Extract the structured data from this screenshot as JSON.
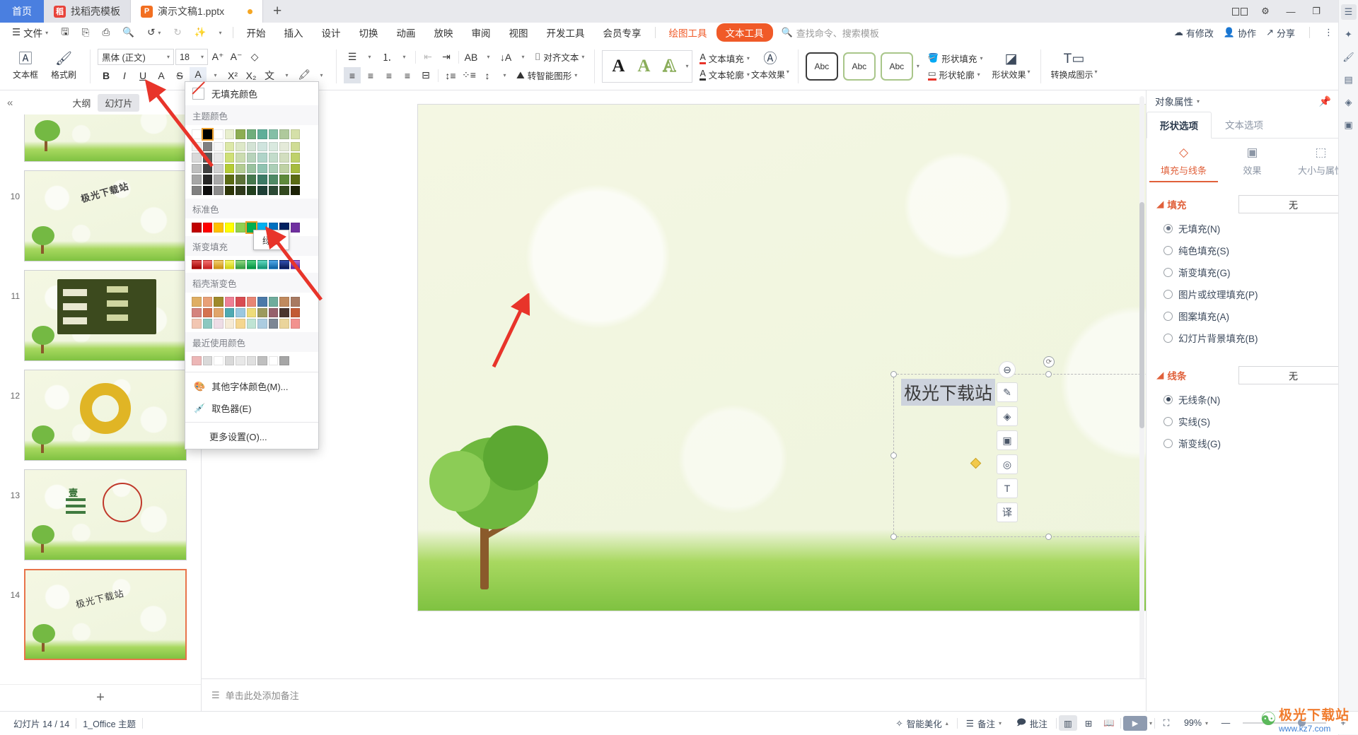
{
  "window": {
    "tabs": [
      {
        "label": "首页",
        "type": "home"
      },
      {
        "label": "找稻壳模板",
        "icon": "docer-icon",
        "type": "inactive"
      },
      {
        "label": "演示文稿1.pptx",
        "icon": "pptx-icon",
        "type": "active",
        "modified": true
      }
    ],
    "new_tab_label": "+",
    "controls": {
      "minimize": "—",
      "restore": "❐",
      "close": "✕",
      "split": "⊞"
    }
  },
  "menubar": {
    "file_label": "文件",
    "quick_icons": [
      "save-icon",
      "save-as-icon",
      "print-icon",
      "print-preview-icon",
      "undo-icon",
      "redo-icon",
      "format-painter-icon",
      "customize-icon"
    ],
    "nav": [
      "开始",
      "插入",
      "设计",
      "切换",
      "动画",
      "放映",
      "审阅",
      "视图",
      "开发工具",
      "会员专享"
    ],
    "contextual_orange": "绘图工具",
    "contextual_pill": "文本工具",
    "search_placeholder": "查找命令、搜索模板",
    "right_items": [
      {
        "label": "有修改",
        "icon": "cloud-sync-icon"
      },
      {
        "label": "协作",
        "icon": "collaborate-icon"
      },
      {
        "label": "分享",
        "icon": "share-icon"
      }
    ],
    "more_icon": "⋮",
    "collapse_icon": "︿"
  },
  "ribbon": {
    "textbox_label": "文本框",
    "format_painter_label": "格式刷",
    "font_name": "黑体 (正文)",
    "font_size": "18",
    "font_buttons": [
      "B",
      "I",
      "U",
      "A",
      "S",
      "A"
    ],
    "font_buttons2": [
      "X²",
      "X₂",
      "wén",
      "highlight"
    ],
    "increase_font": "A⁺",
    "decrease_font": "A⁻",
    "clear_format": "◇",
    "align_text_label": "对齐文本",
    "smartart_label": "转智能图形",
    "wordart_samples": [
      "A",
      "A",
      "A"
    ],
    "text_fill_label": "文本填充",
    "text_outline_label": "文本轮廓",
    "text_effect_label": "文本效果",
    "shape_styles": [
      "Abc",
      "Abc",
      "Abc"
    ],
    "shape_fill_label": "形状填充",
    "shape_outline_label": "形状轮廓",
    "shape_effect_label": "形状效果",
    "convert_to_icon_label": "转换成图示"
  },
  "color_dropdown": {
    "no_fill_label": "无填充颜色",
    "theme_label": "主题颜色",
    "theme_row1": [
      "#FFFFFF",
      "#000000",
      "#FFFFFF",
      "#E8EFCE",
      "#8CAD52",
      "#6FAE7C",
      "#5FAE99",
      "#84BFA6",
      "#AFC99C",
      "#D5E0A8"
    ],
    "theme_selected_index": 1,
    "theme_rows": [
      [
        "#F2F2F2",
        "#808080",
        "#F7F7F7",
        "#DCE8A8",
        "#DDE8C8",
        "#D3E3D5",
        "#CFE4DE",
        "#D9E9DF",
        "#E4EAD9",
        "#CFDC95"
      ],
      [
        "#D9D9D9",
        "#595959",
        "#E8E8E8",
        "#CFE077",
        "#CBDCB0",
        "#B7D3BB",
        "#B0D4C9",
        "#C3DCCB",
        "#D2DEBF",
        "#BFD16B"
      ],
      [
        "#BFBFBF",
        "#404040",
        "#D0D0D0",
        "#B5CC35",
        "#B3CC92",
        "#9AC29F",
        "#90C3B1",
        "#ACCFB7",
        "#BFD2A5",
        "#A6BC3F"
      ],
      [
        "#A6A6A6",
        "#262626",
        "#A8A8A8",
        "#5B6B14",
        "#5D7239",
        "#45784D",
        "#3C7A65",
        "#4F8A65",
        "#5E8A3C",
        "#5A6B14"
      ],
      [
        "#808080",
        "#0D0D0D",
        "#8C8C8C",
        "#2E3608",
        "#2F3A1C",
        "#22401F",
        "#1E4036",
        "#2B4A35",
        "#32491F",
        "#1B2105"
      ]
    ],
    "standard_label": "标准色",
    "standard_colors": [
      "#C00000",
      "#FF0000",
      "#FFC000",
      "#FFFF00",
      "#92D050",
      "#00B050",
      "#00B0F0",
      "#0070C0",
      "#002060",
      "#7030A0"
    ],
    "standard_selected_index": 5,
    "gradient_label": "渐变填充",
    "gradient_colors": [
      "#C00000",
      "#E8514B",
      "#E8B838",
      "#E8E83A",
      "#5FC46A",
      "#21B45A",
      "#2FB899",
      "#1C7FC4",
      "#15327E",
      "#8B45B0"
    ],
    "docer_label": "稻壳渐变色",
    "docer_rows": [
      [
        "#DFAE63",
        "#E8A077",
        "#9E8A2A",
        "#EE8095",
        "#D94C52",
        "#E88574",
        "#4B79A8",
        "#6FAC9C",
        "#C08A5E",
        "#A87A62"
      ],
      [
        "#D4827D",
        "#D4724F",
        "#E0A56A",
        "#4FAAB2",
        "#9AC8E0",
        "#EEDC7A",
        "#9C9A5E",
        "#96606B",
        "#4A352E",
        "#C25B35"
      ],
      [
        "#F2C6B2",
        "#8CC8C0",
        "#EEDDE6",
        "#F6EBD6",
        "#F5D68F",
        "#BFE4D4",
        "#ACCCE0",
        "#7C8694",
        "#EAD49B",
        "#F2918E"
      ]
    ],
    "recent_label": "最近使用颜色",
    "recent_colors": [
      "#EDB7B7",
      "#D9D9D9",
      "#FFFFFF",
      "#D9D9D9",
      "#E8E8E8",
      "#E0E0E0",
      "#BFBFBF",
      "#FFFFFF",
      "#A6A6A6"
    ],
    "menu_items": [
      {
        "label": "其他字体颜色(M)...",
        "icon": "palette-icon"
      },
      {
        "label": "取色器(E)",
        "icon": "eyedropper-icon"
      }
    ],
    "more_settings": "更多设置(O)...",
    "tooltip": "绿色"
  },
  "slide_panel": {
    "collapse_icon": "«",
    "tab_outline": "大纲",
    "tab_slides": "幻灯片",
    "slides": [
      {
        "num": "",
        "type": "partial"
      },
      {
        "num": "10",
        "type": "text"
      },
      {
        "num": "11",
        "type": "diagram"
      },
      {
        "num": "12",
        "type": "ring"
      },
      {
        "num": "13",
        "type": "chart"
      },
      {
        "num": "14",
        "type": "selected",
        "title": "极光下载站"
      }
    ],
    "add_label": "+"
  },
  "canvas": {
    "selected_text": "极光下载站",
    "notes_placeholder": "单击此处添加备注",
    "float_tools": [
      "remove-icon",
      "pen-icon",
      "eraser-icon",
      "crop-icon",
      "locate-icon",
      "text-icon",
      "translate-icon"
    ]
  },
  "properties": {
    "title": "对象属性",
    "pin_icon": "pin-icon",
    "close_icon": "close-icon",
    "tabs": [
      {
        "label": "形状选项",
        "on": true
      },
      {
        "label": "文本选项",
        "on": false
      }
    ],
    "subtabs": [
      {
        "label": "填充与线条",
        "icon": "fill-line-icon",
        "on": true
      },
      {
        "label": "效果",
        "icon": "effects-icon",
        "on": false
      },
      {
        "label": "大小与属性",
        "icon": "size-prop-icon",
        "on": false
      }
    ],
    "fill": {
      "title": "填充",
      "select_value": "无",
      "options": [
        {
          "label": "无填充(N)",
          "checked": true
        },
        {
          "label": "纯色填充(S)",
          "checked": false
        },
        {
          "label": "渐变填充(G)",
          "checked": false
        },
        {
          "label": "图片或纹理填充(P)",
          "checked": false
        },
        {
          "label": "图案填充(A)",
          "checked": false
        },
        {
          "label": "幻灯片背景填充(B)",
          "checked": false
        }
      ]
    },
    "line": {
      "title": "线条",
      "select_value": "无",
      "options": [
        {
          "label": "无线条(N)",
          "checked": true
        },
        {
          "label": "实线(S)",
          "checked": false
        },
        {
          "label": "渐变线(G)",
          "checked": false
        }
      ]
    },
    "rail_icons": [
      "feedback-icon",
      "star-icon",
      "brush-icon",
      "chart-icon",
      "shape-icon",
      "image-icon"
    ]
  },
  "status": {
    "slide_count": "幻灯片 14 / 14",
    "theme": "1_Office 主题",
    "beautify": "智能美化",
    "notes": "备注",
    "comments": "批注",
    "view_buttons": [
      "normal-view-icon",
      "sorter-view-icon",
      "reading-view-icon"
    ],
    "play_label": "▶",
    "fit_icon": "fit-screen-icon",
    "zoom": "99%",
    "zoom_minus": "—",
    "zoom_plus": "+"
  },
  "watermark": {
    "title": "极光下载站",
    "url": "www.kz7.com"
  },
  "colors": {
    "accent_orange": "#f05a28",
    "brand_blue": "#4a7fe0",
    "panel_text": "#3d4a5c",
    "arrow_red": "#e8342a"
  }
}
